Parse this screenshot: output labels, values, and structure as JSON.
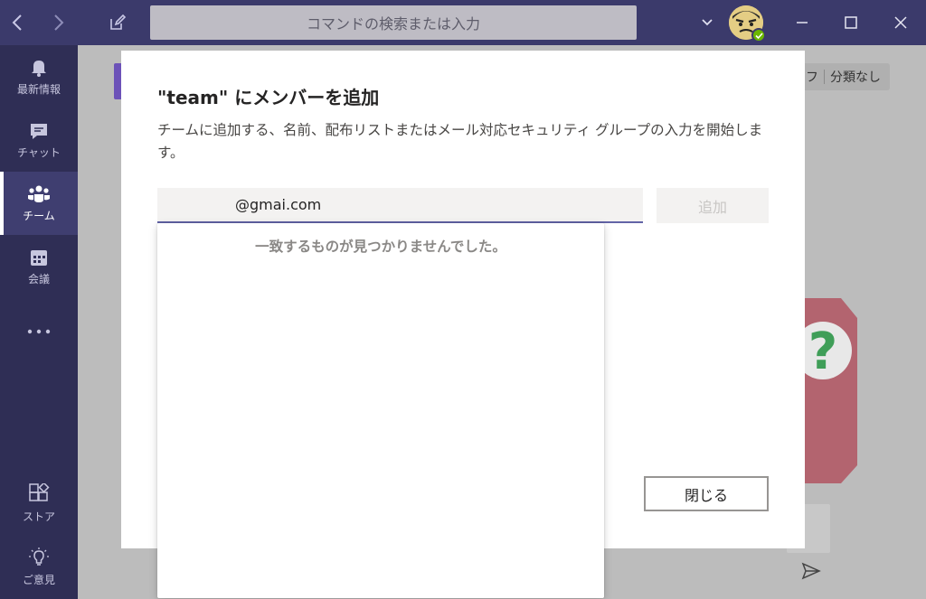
{
  "titlebar": {
    "search_placeholder": "コマンドの検索または入力",
    "back_icon": "chevron-left-icon",
    "forward_icon": "chevron-right-icon",
    "compose_icon": "compose-icon"
  },
  "appbar": {
    "items": [
      {
        "label": "最新情報",
        "icon": "bell-icon"
      },
      {
        "label": "チャット",
        "icon": "chat-icon"
      },
      {
        "label": "チーム",
        "icon": "teams-icon",
        "active": true
      },
      {
        "label": "会議",
        "icon": "calendar-icon"
      },
      {
        "label": "",
        "icon": "more-icon"
      }
    ],
    "bottom_items": [
      {
        "label": "ストア",
        "icon": "store-icon"
      },
      {
        "label": "ご意見",
        "icon": "lightbulb-icon"
      }
    ]
  },
  "background": {
    "tag_left": "フ",
    "tag_right": "分類なし"
  },
  "dialog": {
    "title": "\"team\" にメンバーを追加",
    "description": "チームに追加する、名前、配布リストまたはメール対応セキュリティ グループの入力を開始します。",
    "input_value": "@gmai.com",
    "add_button": "追加",
    "close_button": "閉じる"
  },
  "dropdown": {
    "message": "一致するものが見つかりませんでした。"
  },
  "colors": {
    "titlebar": "#3b3a6b",
    "appbar": "#2f2e55",
    "accent": "#6264a7",
    "status_available": "#6bb700"
  }
}
